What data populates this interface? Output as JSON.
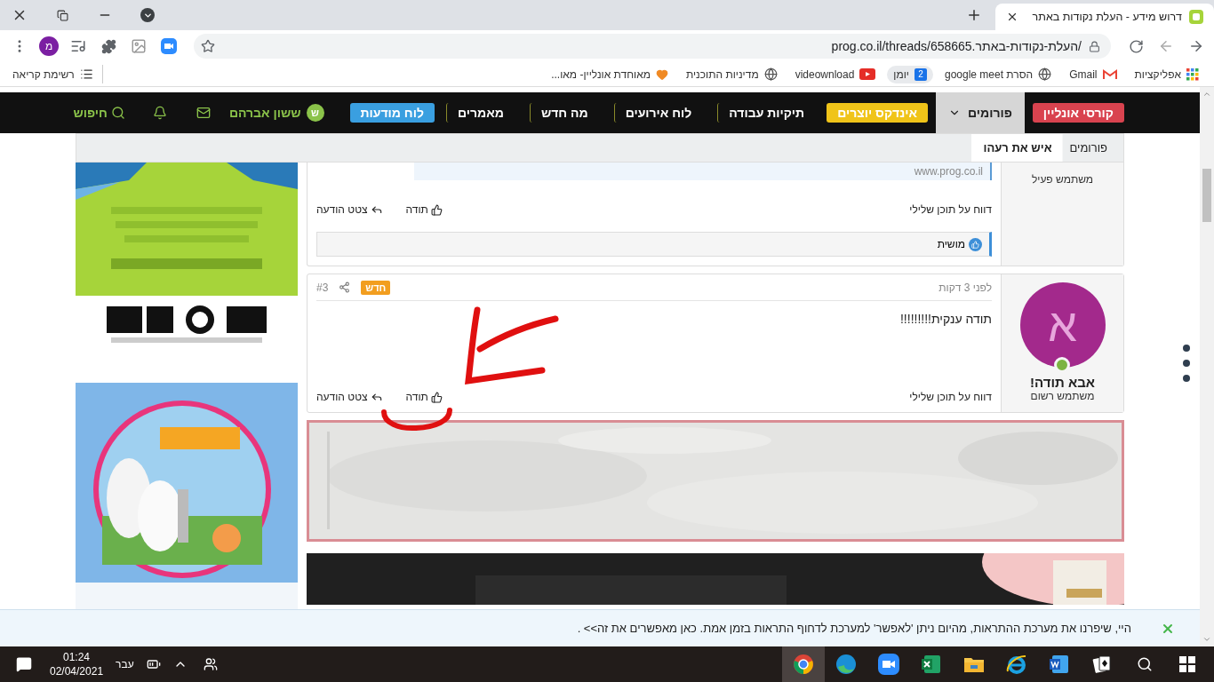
{
  "browser": {
    "tab": {
      "title": "דרוש מידע - העלת נקודות באתר"
    },
    "profile_initial": "מ",
    "address": "prog.co.il/threads/658665.העלת-נקודות-באתר/",
    "bookmarks": [
      {
        "kind": "apps",
        "label": "אפליקציות",
        "highlighted": false
      },
      {
        "kind": "mail",
        "label": "Gmail",
        "highlighted": false
      },
      {
        "kind": "globe",
        "label": "הסרת google meet",
        "highlighted": false
      },
      {
        "kind": "calendar",
        "label": "יומן",
        "badge": "2",
        "highlighted": true
      },
      {
        "kind": "video",
        "label": "videownload",
        "highlighted": false
      },
      {
        "kind": "globe",
        "label": "מדיניות התוכנית",
        "highlighted": false
      },
      {
        "kind": "heart",
        "label": "מאוחדת אונליין- מאו...",
        "highlighted": false
      }
    ],
    "reading_list": "רשימת קריאה"
  },
  "site_nav": {
    "items": [
      {
        "kind": "red",
        "label": "קורסי אונליין",
        "selected": false
      },
      {
        "kind": "dropdown",
        "label": "פורומים",
        "selected": true
      },
      {
        "kind": "yellow",
        "label": "אינדקס יוצרים",
        "selected": false
      },
      {
        "kind": "link",
        "label": "תיקיות עבודה",
        "selected": false
      },
      {
        "kind": "link",
        "label": "לוח אירועים",
        "selected": false
      },
      {
        "kind": "link",
        "label": "מה חדש",
        "selected": false
      },
      {
        "kind": "link",
        "label": "מאמרים",
        "selected": false
      },
      {
        "kind": "blue",
        "label": "לוח מודעות",
        "selected": false
      }
    ],
    "user": {
      "initial": "ש",
      "name": "ששון אברהם"
    },
    "search": "חיפוש"
  },
  "breadcrumbs": [
    {
      "label": "פורומים",
      "selected": false
    },
    {
      "label": "איש את רעהו",
      "selected": true
    }
  ],
  "posts": [
    {
      "role": "משתמש פעיל",
      "signature": "www.prog.co.il",
      "report": "דווח על תוכן שלילי",
      "like": "תודה",
      "quote": "צטט הודעה",
      "likes": [
        "מושית"
      ]
    },
    {
      "avatar_letter": "א",
      "online": true,
      "name": "אבא תודה!",
      "role": "משתמש רשום",
      "time": "לפני 3 דקות",
      "badge": "חדש",
      "number": "#3",
      "body": "תודה ענקית!!!!!!!!!",
      "report": "דווח על תוכן שלילי",
      "like": "תודה",
      "quote": "צטט הודעה"
    }
  ],
  "notification": {
    "text": "היי, שיפרנו את מערכת ההתראות, מהיום ניתן 'לאפשר' למערכת לדחוף התראות בזמן אמת. כאן מאפשרים את זה>> ."
  },
  "taskbar": {
    "time": "01:24",
    "date": "02/04/2021",
    "language": "עבר"
  }
}
